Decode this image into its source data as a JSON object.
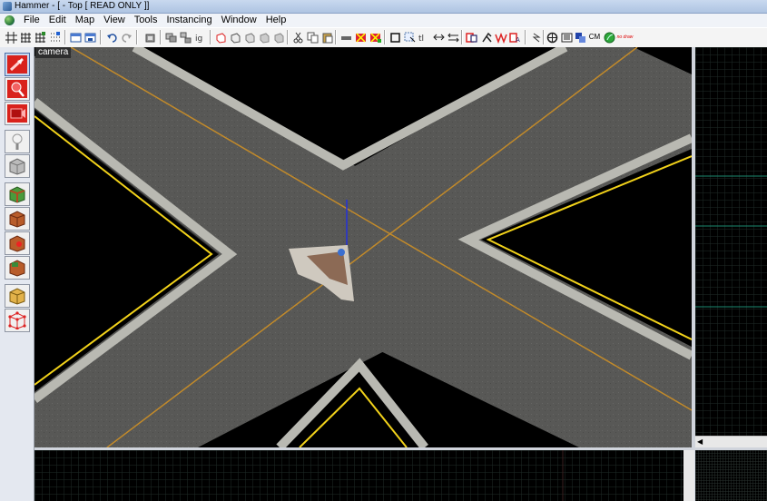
{
  "window": {
    "title": "Hammer - [ - Top [ READ ONLY ]]"
  },
  "menu": {
    "items": [
      "File",
      "Edit",
      "Map",
      "View",
      "Tools",
      "Instancing",
      "Window",
      "Help"
    ]
  },
  "toolbar": {
    "text_buttons": {
      "cm": "CM",
      "no_draw": "no draw"
    },
    "icons": [
      "grid-icon",
      "grid-smaller-icon",
      "grid-larger-icon",
      "grid-dots-icon",
      "load-window-state-icon",
      "save-window-state-icon",
      "undo-icon",
      "redo-icon",
      "carve-icon",
      "group-icon",
      "ungroup-icon",
      "ignore-groups-icon",
      "hide-selected-icon",
      "show-all-icon",
      "hide-unselected-icon",
      "auto-visgroup-icon",
      "cut-icon",
      "copy-icon",
      "paste-icon",
      "texture-lock-icon",
      "texture-scale-lock-icon",
      "texture-align-icon",
      "select-box-icon",
      "toggle-selection-icon",
      "snap-to-grid-icon",
      "move-icon",
      "displacement-icon",
      "entity-report-icon",
      "check-problems-icon",
      "radius-culling-icon",
      "compile-icon",
      "cordon-icon",
      "quick-hide-icon",
      "model-browser-icon",
      "cm-icon",
      "leaf-icon",
      "no-draw-icon"
    ]
  },
  "tools": [
    {
      "name": "selection-tool",
      "icon": "arrow-cursor-icon"
    },
    {
      "name": "magnify-tool",
      "icon": "magnifier-icon"
    },
    {
      "name": "camera-tool",
      "icon": "camera-icon"
    },
    {
      "name": "entity-tool",
      "icon": "light-bulb-icon"
    },
    {
      "name": "block-tool",
      "icon": "gray-block-icon"
    },
    {
      "name": "texture-application-tool",
      "icon": "textured-block-icon"
    },
    {
      "name": "apply-current-texture-tool",
      "icon": "brick-block-icon"
    },
    {
      "name": "decal-tool",
      "icon": "decal-block-icon"
    },
    {
      "name": "overlay-tool",
      "icon": "overlay-block-icon"
    },
    {
      "name": "clipping-tool",
      "icon": "clip-block-icon"
    },
    {
      "name": "vertex-tool",
      "icon": "vertex-icon"
    }
  ],
  "views": {
    "camera_label": "camera"
  },
  "colors": {
    "road": "#5a5a58",
    "curb_light": "#b9b9b2",
    "center_line": "#c28a2a",
    "yellow_edge": "#f2d21a",
    "grid": "#1b2a25",
    "grid_accent": "#1b8a70"
  }
}
